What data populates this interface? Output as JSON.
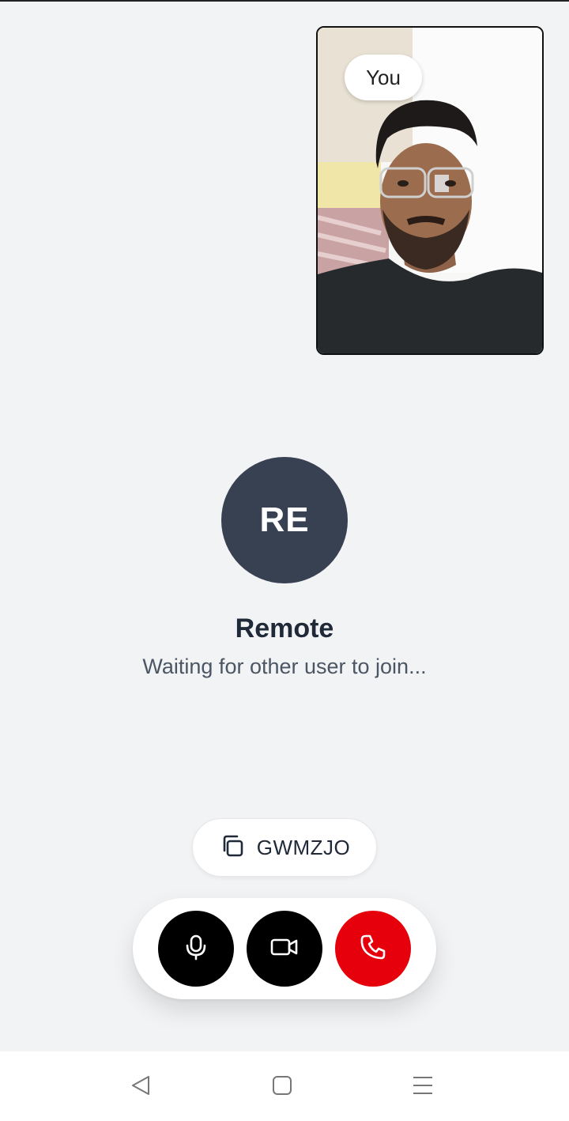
{
  "self_view": {
    "label": "You"
  },
  "remote": {
    "initials": "RE",
    "name": "Remote",
    "status": "Waiting for other user to join..."
  },
  "room": {
    "code": "GWMZJO"
  },
  "controls": {
    "icons": [
      "microphone-icon",
      "video-camera-icon",
      "phone-icon"
    ],
    "end_color": "#e5000b"
  },
  "system_nav": {
    "icons": [
      "back-icon",
      "home-icon",
      "recents-icon"
    ]
  }
}
